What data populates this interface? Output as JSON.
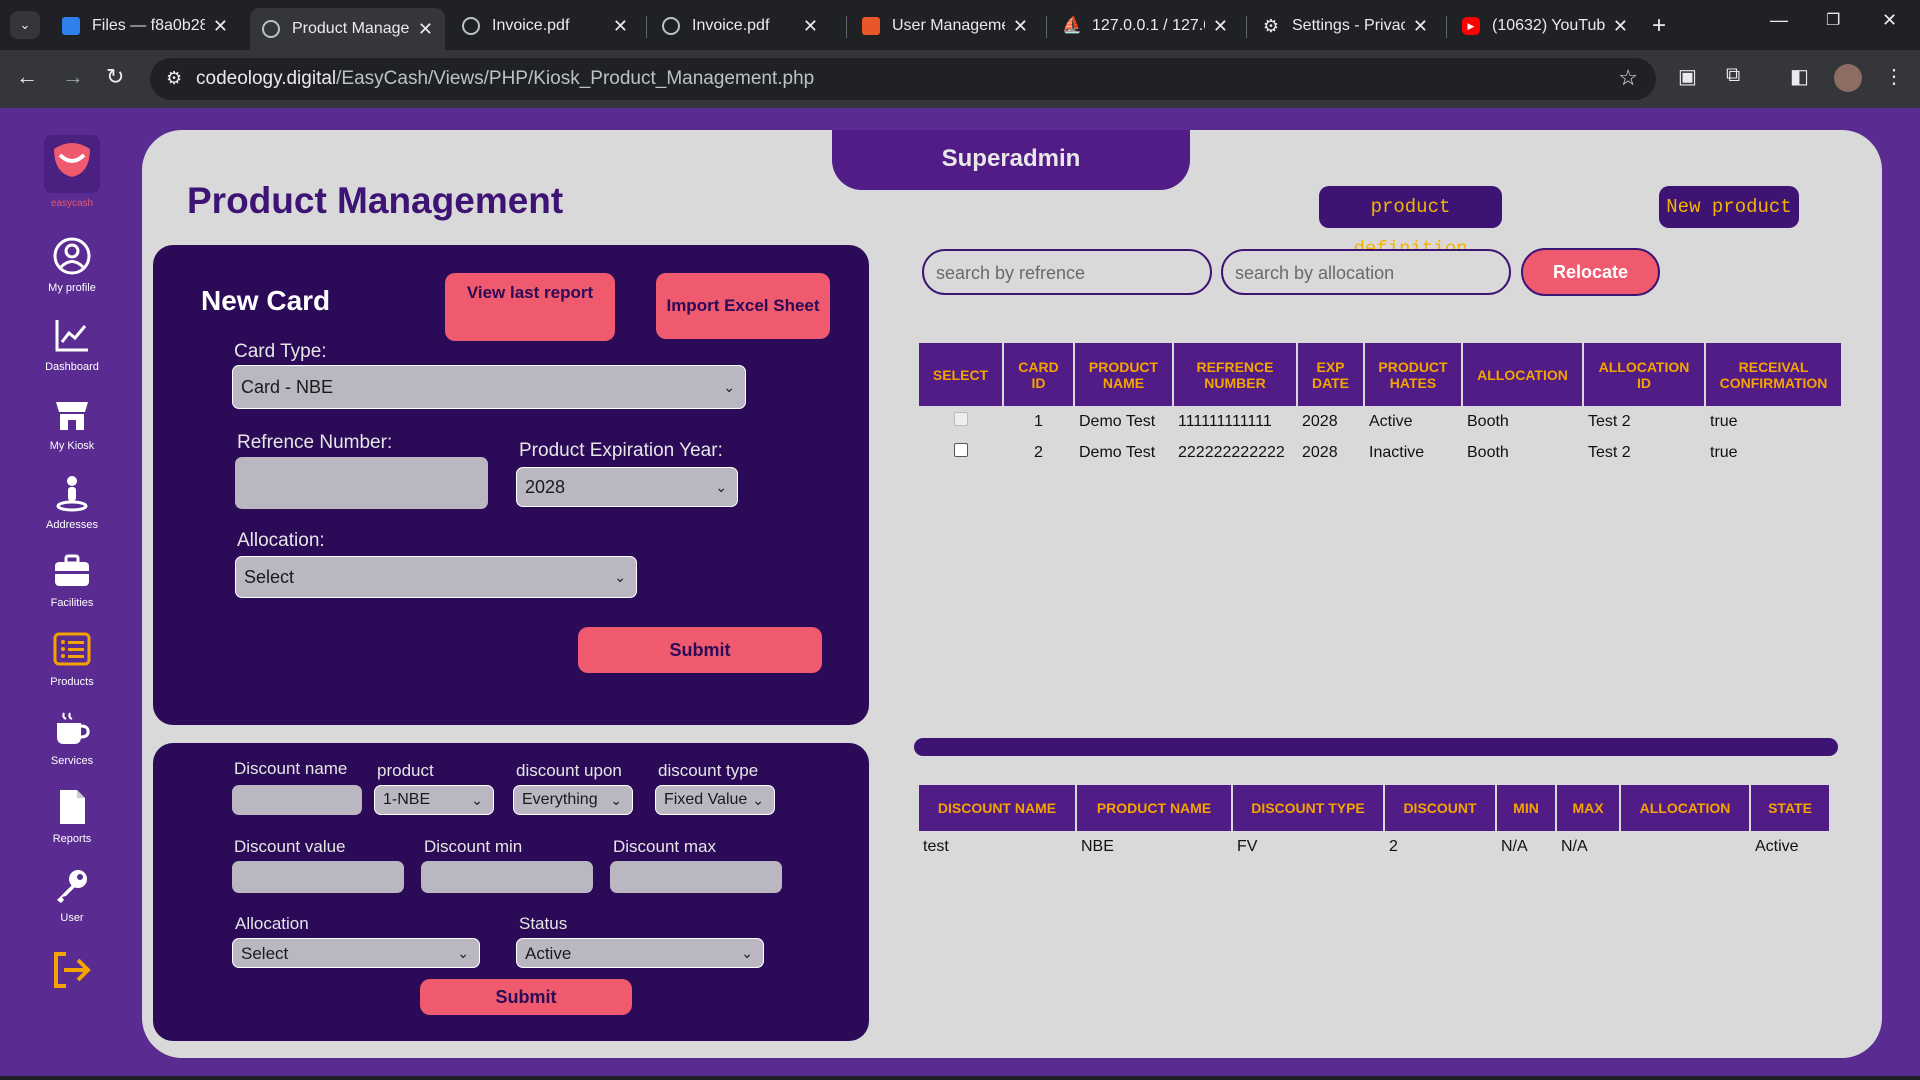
{
  "browser": {
    "tabs": [
      {
        "title": "Files — f8a0b28",
        "active": false,
        "icon": "files-favicon"
      },
      {
        "title": "Product Manage",
        "active": true,
        "icon": "globe-favicon"
      },
      {
        "title": "Invoice.pdf",
        "active": false,
        "icon": "globe-favicon"
      },
      {
        "title": "Invoice.pdf",
        "active": false,
        "icon": "globe-favicon"
      },
      {
        "title": "User Managemen",
        "active": false,
        "icon": "codeology-favicon"
      },
      {
        "title": "127.0.0.1 / 127.0.",
        "active": false,
        "icon": "phpmyadmin-favicon"
      },
      {
        "title": "Settings - Privac",
        "active": false,
        "icon": "gear-favicon"
      },
      {
        "title": "(10632) YouTube",
        "active": false,
        "icon": "youtube-favicon"
      }
    ],
    "url_host": "codeology.digital",
    "url_path": "/EasyCash/Views/PHP/Kiosk_Product_Management.php"
  },
  "sidebar": {
    "logo_text": "easycash",
    "items": [
      {
        "label": "My profile",
        "icon": "user-circle-icon"
      },
      {
        "label": "Dashboard",
        "icon": "chart-line-icon"
      },
      {
        "label": "My Kiosk",
        "icon": "store-icon"
      },
      {
        "label": "Addresses",
        "icon": "map-pin-person-icon"
      },
      {
        "label": "Facilities",
        "icon": "briefcase-icon"
      },
      {
        "label": "Products",
        "icon": "list-icon"
      },
      {
        "label": "Services",
        "icon": "coffee-icon"
      },
      {
        "label": "Reports",
        "icon": "document-icon"
      },
      {
        "label": "User",
        "icon": "key-icon"
      }
    ],
    "logout_icon": "logout-icon",
    "accent": "#f5a300"
  },
  "header": {
    "role": "Superadmin",
    "title": "Product Management",
    "product_definition_btn": "product definition",
    "new_product_btn": "New product"
  },
  "new_card": {
    "title": "New Card",
    "view_report_btn": "View last report",
    "import_btn": "Import Excel Sheet",
    "card_type_label": "Card Type:",
    "card_type_value": "Card - NBE",
    "ref_label": "Refrence Number:",
    "ref_value": "",
    "exp_label": "Product Expiration Year:",
    "exp_value": "2028",
    "alloc_label": "Allocation:",
    "alloc_value": "Select",
    "submit": "Submit"
  },
  "discount_form": {
    "name_label": "Discount name",
    "product_label": "product",
    "product_value": "1-NBE",
    "upon_label": "discount upon",
    "upon_value": "Everything",
    "type_label": "discount type",
    "type_value": "Fixed Value",
    "value_label": "Discount value",
    "min_label": "Discount min",
    "max_label": "Discount max",
    "alloc_label": "Allocation",
    "alloc_value": "Select",
    "status_label": "Status",
    "status_value": "Active",
    "submit": "Submit"
  },
  "search": {
    "ref_placeholder": "search by refrence",
    "alloc_placeholder": "search by allocation",
    "relocate_btn": "Relocate"
  },
  "cards_table": {
    "headers": [
      "SELECT",
      "CARD ID",
      "PRODUCT NAME",
      "REFRENCE NUMBER",
      "EXP DATE",
      "PRODUCT HATES",
      "ALLOCATION",
      "ALLOCATION ID",
      "RECEIVAL CONFIRMATION"
    ],
    "rows": [
      {
        "card_id": "1",
        "product_name": "Demo Test",
        "ref": "111111111111",
        "exp": "2028",
        "state": "Active",
        "allocation": "Booth",
        "alloc_id": "Test 2",
        "receival": "true",
        "selectable": false
      },
      {
        "card_id": "2",
        "product_name": "Demo Test",
        "ref": "222222222222",
        "exp": "2028",
        "state": "Inactive",
        "allocation": "Booth",
        "alloc_id": "Test 2",
        "receival": "true",
        "selectable": true
      }
    ]
  },
  "discount_table": {
    "headers": [
      "DISCOUNT NAME",
      "PRODUCT NAME",
      "DISCOUNT TYPE",
      "DISCOUNT",
      "MIN",
      "MAX",
      "ALLOCATION",
      "STATE"
    ],
    "rows": [
      {
        "name": "test",
        "product": "NBE",
        "type": "FV",
        "discount": "2",
        "min": "N/A",
        "max": "N/A",
        "allocation": "",
        "state": "Active"
      }
    ]
  }
}
